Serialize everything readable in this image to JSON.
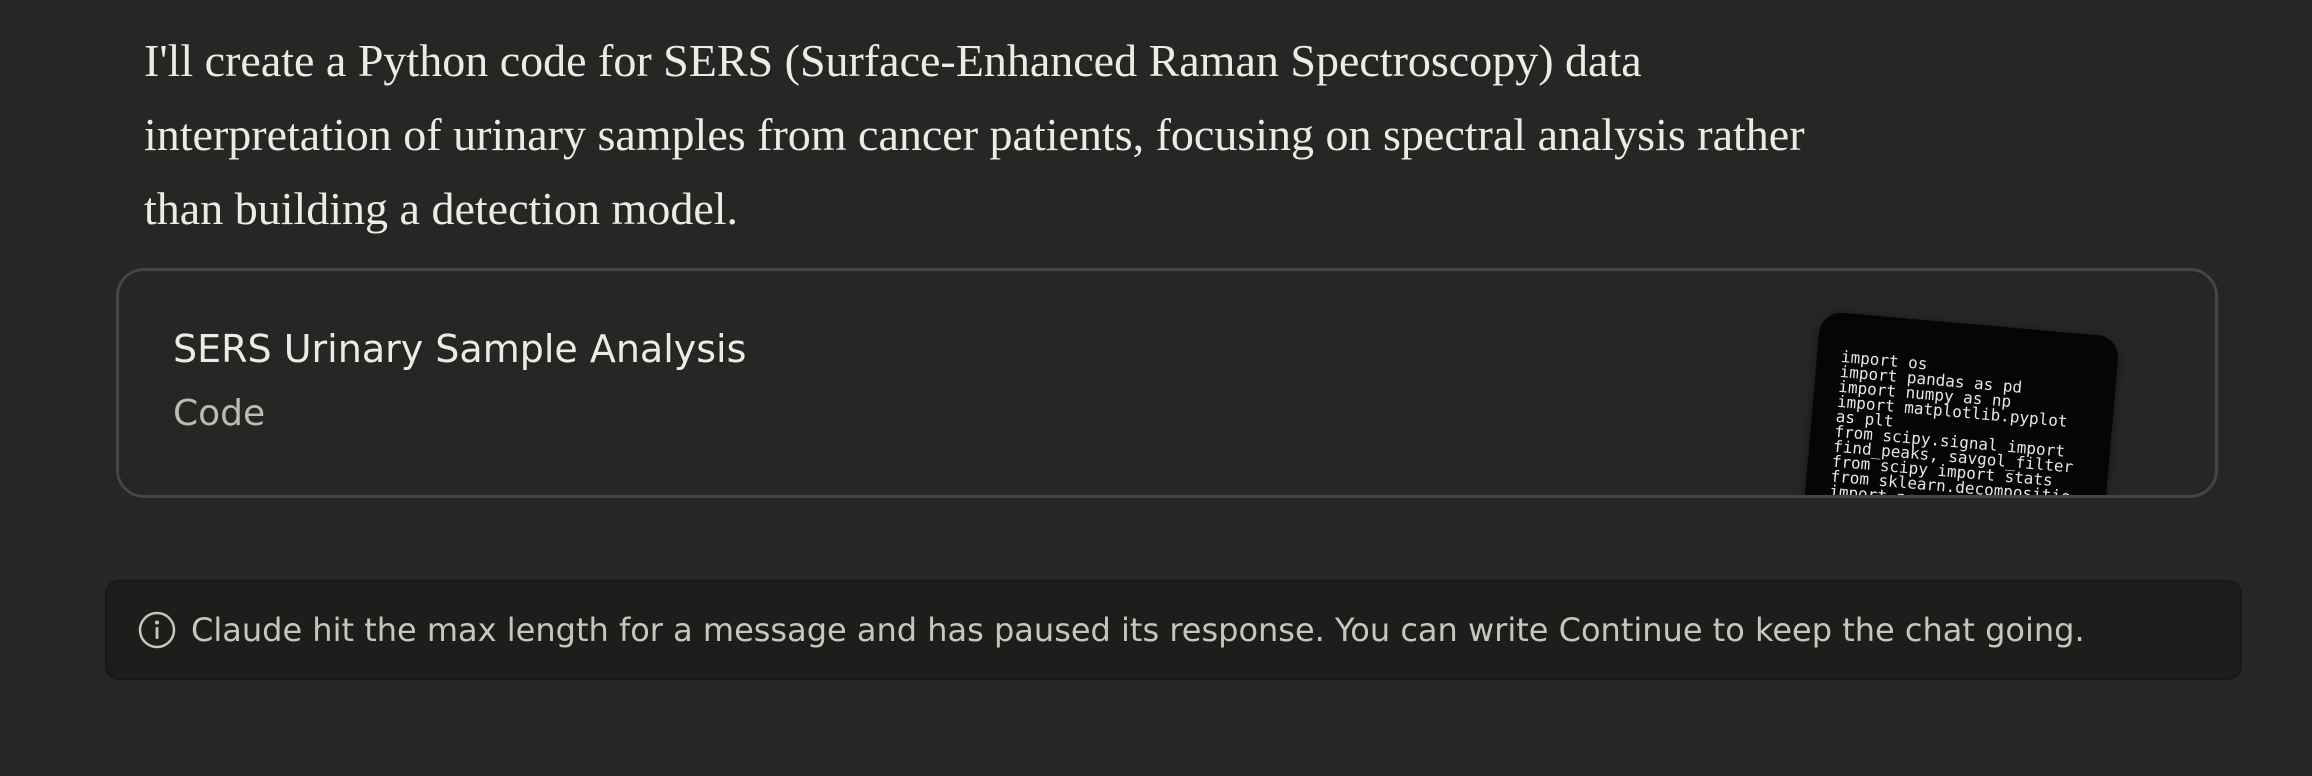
{
  "message": {
    "lines": [
      "I'll create a Python code for SERS (Surface-Enhanced Raman Spectroscopy) data",
      "interpretation of urinary samples from cancer patients, focusing on spectral analysis rather",
      "than building a detection model."
    ]
  },
  "artifact": {
    "title": "SERS Urinary Sample Analysis",
    "type_label": "Code",
    "code_preview": [
      "import os",
      "import pandas as pd",
      "import numpy as np",
      "import matplotlib.pyplot",
      "as plt",
      "from scipy.signal import",
      "find_peaks, savgol_filter",
      "from scipy import stats",
      "from sklearn.decompositio",
      "import pca"
    ]
  },
  "notice": {
    "icon": "info-icon",
    "text": "Claude hit the max length for a message and has paused its response. You can write Continue to keep the chat going."
  },
  "colors": {
    "background": "#262624",
    "card_border": "#454542",
    "notice_background": "#1d1d1c",
    "code_background": "#050505"
  }
}
